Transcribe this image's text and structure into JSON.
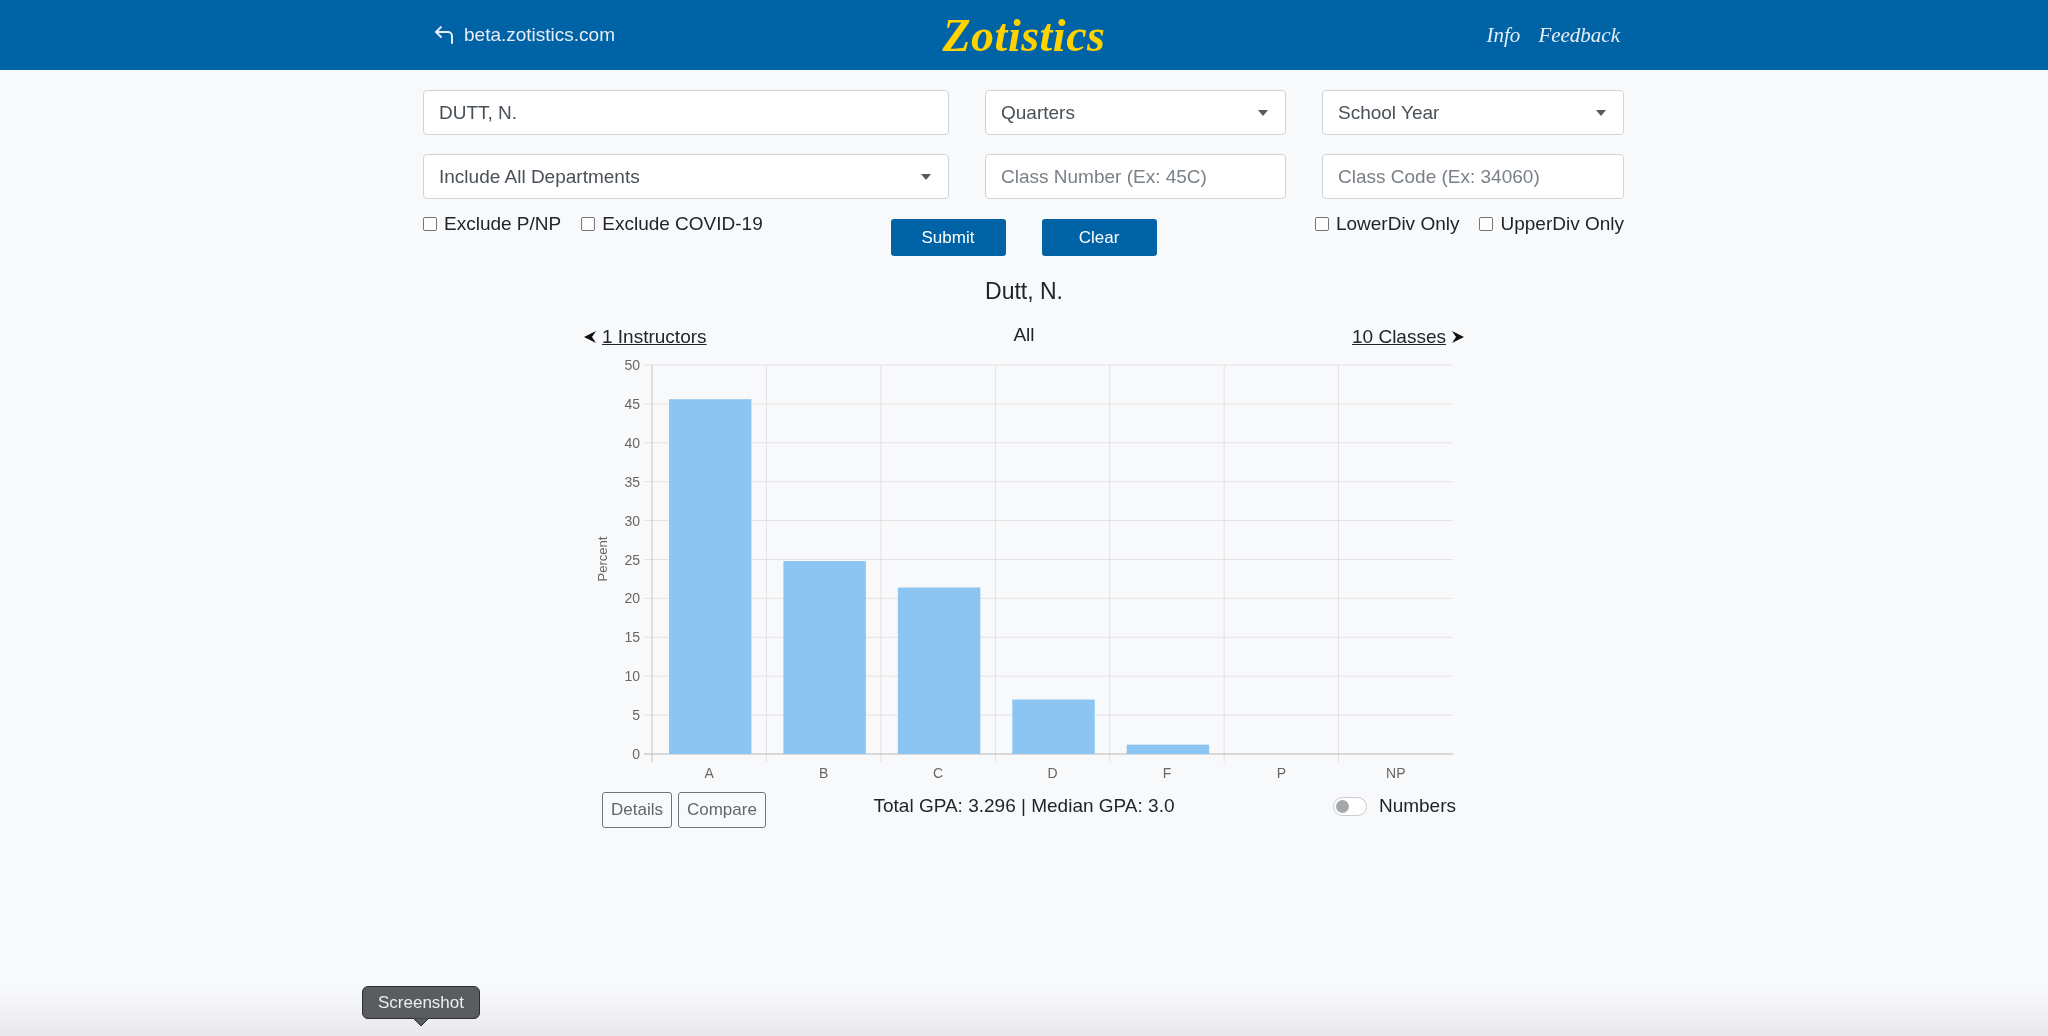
{
  "header": {
    "back_link": "beta.zotistics.com",
    "logo": "Zotistics",
    "links": [
      "Info",
      "Feedback"
    ]
  },
  "form": {
    "fields": [
      {
        "kind": "text",
        "value": "DUTT, N."
      },
      {
        "kind": "select",
        "value": "Quarters"
      },
      {
        "kind": "select",
        "value": "School Year"
      },
      {
        "kind": "select",
        "value": "Include All Departments"
      },
      {
        "kind": "text",
        "placeholder": "Class Number (Ex: 45C)"
      },
      {
        "kind": "text",
        "placeholder": "Class Code (Ex: 34060)"
      }
    ],
    "checkboxes_left": [
      {
        "label": "Exclude P/NP",
        "checked": false
      },
      {
        "label": "Exclude COVID-19",
        "checked": false
      }
    ],
    "buttons": [
      "Submit",
      "Clear"
    ],
    "checkboxes_right": [
      {
        "label": "LowerDiv Only",
        "checked": false
      },
      {
        "label": "UpperDiv Only",
        "checked": false
      }
    ]
  },
  "results": {
    "title": "Dutt, N.",
    "prev_link": "1 Instructors",
    "filter": "All",
    "next_link": "10 Classes",
    "chart_data": {
      "type": "bar",
      "ylabel": "Percent",
      "categories": [
        "A",
        "B",
        "C",
        "D",
        "F",
        "P",
        "NP"
      ],
      "values": [
        45.6,
        24.8,
        21.4,
        7.0,
        1.2,
        0,
        0
      ],
      "ylim": [
        0,
        50
      ],
      "yticks": [
        0,
        5,
        10,
        15,
        20,
        25,
        30,
        35,
        40,
        45,
        50
      ],
      "grid": true
    },
    "buttons": [
      "Details",
      "Compare"
    ],
    "summary": "Total GPA: 3.296 | Median GPA: 3.0",
    "numbers_toggle": {
      "label": "Numbers",
      "on": false
    }
  },
  "tooltip": {
    "text": "Screenshot"
  }
}
